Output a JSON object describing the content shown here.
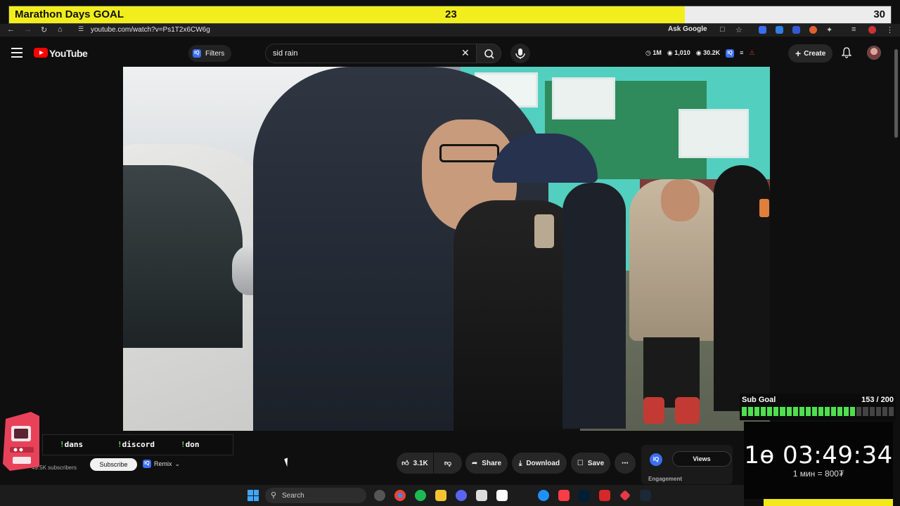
{
  "goal": {
    "title": "Marathon Days GOAL",
    "current": "23",
    "target": "30",
    "progress": 0.766
  },
  "browser": {
    "url": "youtube.com/watch?v=Ps1T2x6CW6g",
    "ask_google": "Ask Google",
    "icons": [
      "back-arrow",
      "forward-arrow",
      "reload",
      "home",
      "site-info",
      "star",
      "extensions",
      "menu"
    ]
  },
  "youtube": {
    "logo_text": "YouTube",
    "filters_label": "Filters",
    "search_value": "sid rain",
    "stats": {
      "subs": "1M",
      "videos": "1,010",
      "views": "30.2K"
    },
    "create_label": "Create"
  },
  "video_meta": {
    "subscribers": "49.5K subscribers",
    "subscribe_label": "Subscribe",
    "remix_label": "Remix",
    "likes": "3.1K",
    "share_label": "Share",
    "download_label": "Download",
    "save_label": "Save"
  },
  "chat_commands": [
    {
      "bang": "!",
      "cmd": "dans"
    },
    {
      "bang": "!",
      "cmd": "discord"
    },
    {
      "bang": "!",
      "cmd": "don"
    }
  ],
  "side_widget": {
    "tab_label": "Views",
    "section_label": "Engagement"
  },
  "sub_goal": {
    "title": "Sub Goal",
    "count": "153 / 200",
    "fraction": 0.765
  },
  "timer": {
    "time": "1ө 03:49:34",
    "rate": "1 мин = 800₮"
  },
  "taskbar": {
    "search_label": "Search"
  },
  "colors": {
    "goal_fill": "#f2ee1e",
    "yt_red": "#ff0000",
    "sub_goal_on": "#4ee04e",
    "timer_bar": "#f2e81a"
  }
}
